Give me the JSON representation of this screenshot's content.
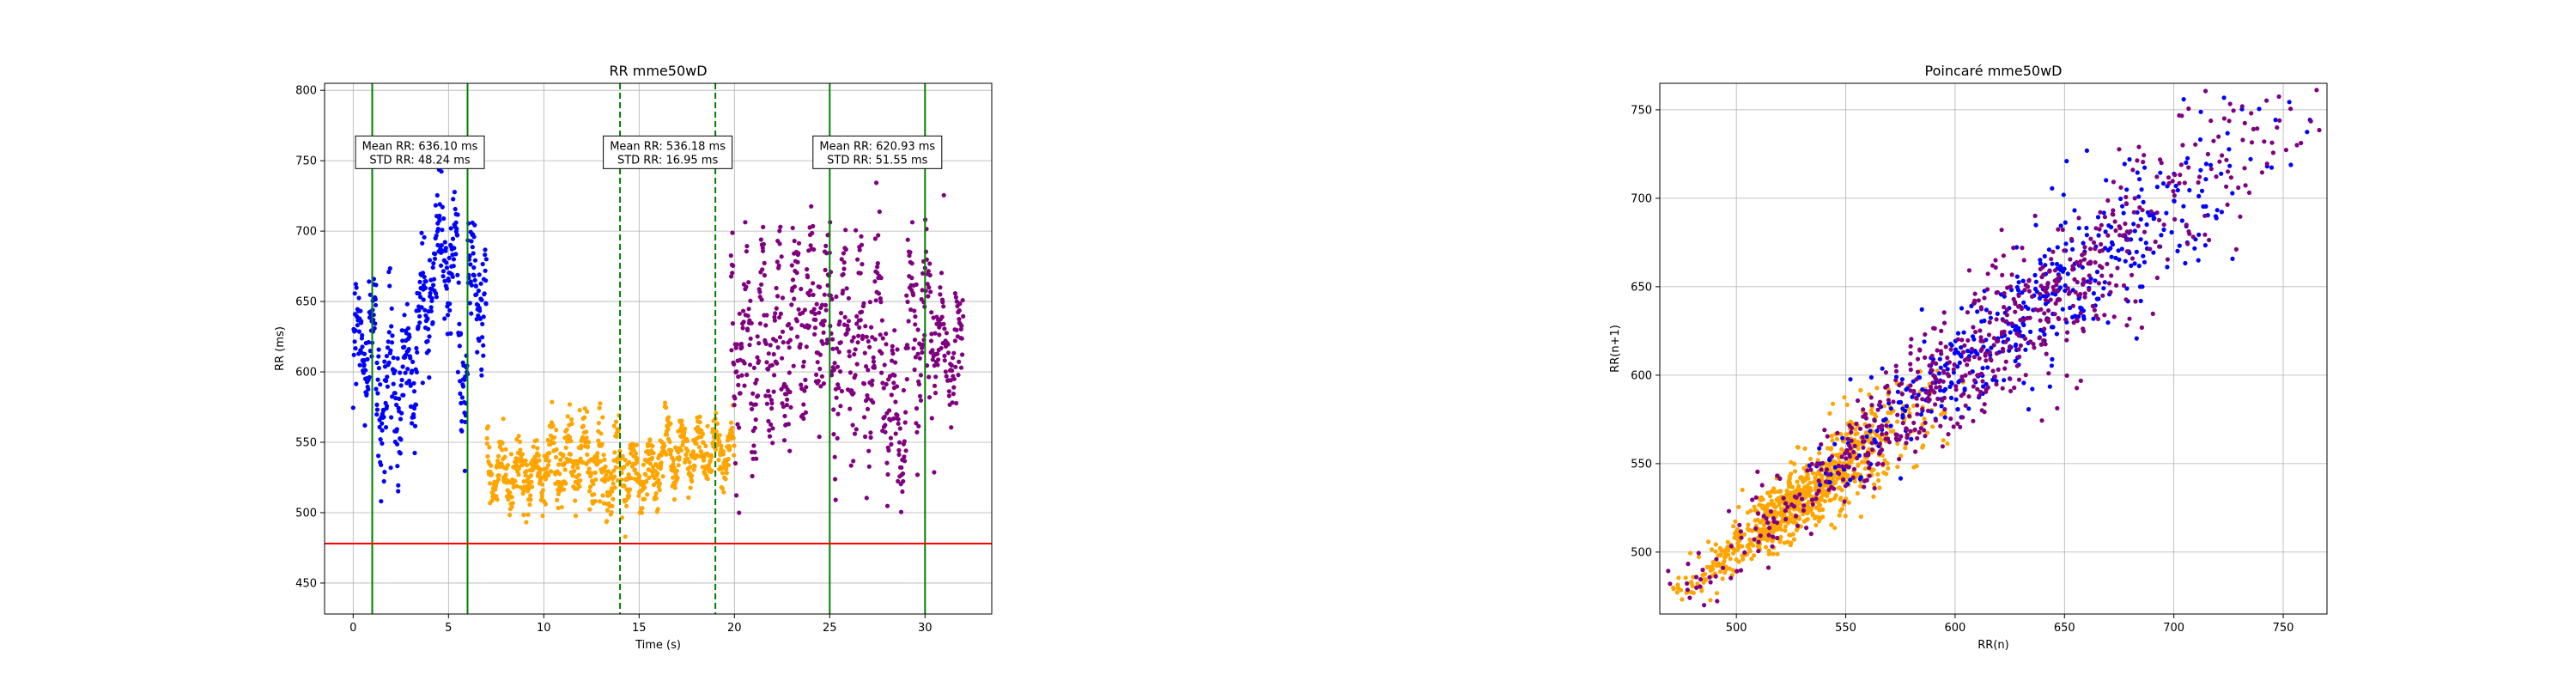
{
  "chart_data": [
    {
      "type": "scatter",
      "title": "RR mme50wD",
      "xlabel": "Time (s)",
      "ylabel": "RR (ms)",
      "xlim": [
        -1.5,
        33.5
      ],
      "ylim": [
        428,
        805
      ],
      "xticks": [
        0,
        5,
        10,
        15,
        20,
        25,
        30
      ],
      "yticks": [
        450,
        500,
        550,
        600,
        650,
        700,
        750,
        800
      ],
      "grid": true,
      "series": [
        {
          "color": "#0000ff",
          "segments": [
            {
              "t0": 0,
              "t1": 1.2,
              "base": 620,
              "spread": 30
            },
            {
              "t0": 1.2,
              "t1": 2.6,
              "base": 590,
              "spread": 40
            },
            {
              "t0": 2.6,
              "t1": 3.3,
              "base": 600,
              "spread": 30
            },
            {
              "t0": 3.3,
              "t1": 4.0,
              "base": 645,
              "spread": 35
            },
            {
              "t0": 4.0,
              "t1": 5.5,
              "base": 680,
              "spread": 30
            },
            {
              "t0": 5.5,
              "t1": 6.0,
              "base": 615,
              "spread": 40
            },
            {
              "t0": 6.0,
              "t1": 7.0,
              "base": 660,
              "spread": 35
            }
          ],
          "count": 460
        },
        {
          "color": "#ffa500",
          "segments": [
            {
              "t0": 7.0,
              "t1": 10.0,
              "base": 528,
              "spread": 18
            },
            {
              "t0": 10.0,
              "t1": 13.0,
              "base": 538,
              "spread": 22
            },
            {
              "t0": 13.0,
              "t1": 16.0,
              "base": 527,
              "spread": 18
            },
            {
              "t0": 16.0,
              "t1": 20.0,
              "base": 543,
              "spread": 17
            }
          ],
          "count": 820
        },
        {
          "color": "#800080",
          "segments": [
            {
              "t0": 19.8,
              "t1": 23.0,
              "base": 620,
              "spread": 50
            },
            {
              "t0": 23.0,
              "t1": 25.0,
              "base": 640,
              "spread": 45
            },
            {
              "t0": 25.0,
              "t1": 28.0,
              "base": 625,
              "spread": 50
            },
            {
              "t0": 28.0,
              "t1": 29.0,
              "base": 560,
              "spread": 40
            },
            {
              "t0": 29.0,
              "t1": 31.0,
              "base": 628,
              "spread": 45
            },
            {
              "t0": 31.0,
              "t1": 32.0,
              "base": 615,
              "spread": 30
            }
          ],
          "count": 700
        }
      ],
      "vlines": [
        {
          "x": 1,
          "color": "#008000",
          "style": "solid"
        },
        {
          "x": 6,
          "color": "#008000",
          "style": "solid"
        },
        {
          "x": 14,
          "color": "#008000",
          "style": "dashed"
        },
        {
          "x": 19,
          "color": "#008000",
          "style": "dashed"
        },
        {
          "x": 25,
          "color": "#008000",
          "style": "solid"
        },
        {
          "x": 30,
          "color": "#008000",
          "style": "solid"
        }
      ],
      "hline": {
        "y": 478,
        "color": "#ff0000"
      },
      "annotations": [
        {
          "x": 3.5,
          "y": 756,
          "lines": [
            "Mean RR: 636.10 ms",
            "STD RR: 48.24 ms"
          ]
        },
        {
          "x": 16.5,
          "y": 756,
          "lines": [
            "Mean RR: 536.18 ms",
            "STD RR: 16.95 ms"
          ]
        },
        {
          "x": 27.5,
          "y": 756,
          "lines": [
            "Mean RR: 620.93 ms",
            "STD RR: 51.55 ms"
          ]
        }
      ]
    },
    {
      "type": "scatter",
      "title": "Poincaré mme50wD",
      "xlabel": "RR(n)",
      "ylabel": "RR(n+1)",
      "xlim": [
        465,
        770
      ],
      "ylim": [
        465,
        765
      ],
      "xticks": [
        500,
        550,
        600,
        650,
        700,
        750
      ],
      "yticks": [
        500,
        550,
        600,
        650,
        700,
        750
      ],
      "grid": true,
      "series": [
        {
          "color": "#ffa500",
          "center": [
            532,
            532
          ],
          "range": [
            478,
            585
          ],
          "spread": 11,
          "count": 800
        },
        {
          "color": "#0000ff",
          "center": [
            640,
            640
          ],
          "range": [
            540,
            750
          ],
          "spread": 20,
          "count": 450
        },
        {
          "color": "#800080",
          "center": [
            620,
            620
          ],
          "range": [
            480,
            755
          ],
          "spread": 20,
          "count": 700
        }
      ]
    }
  ]
}
